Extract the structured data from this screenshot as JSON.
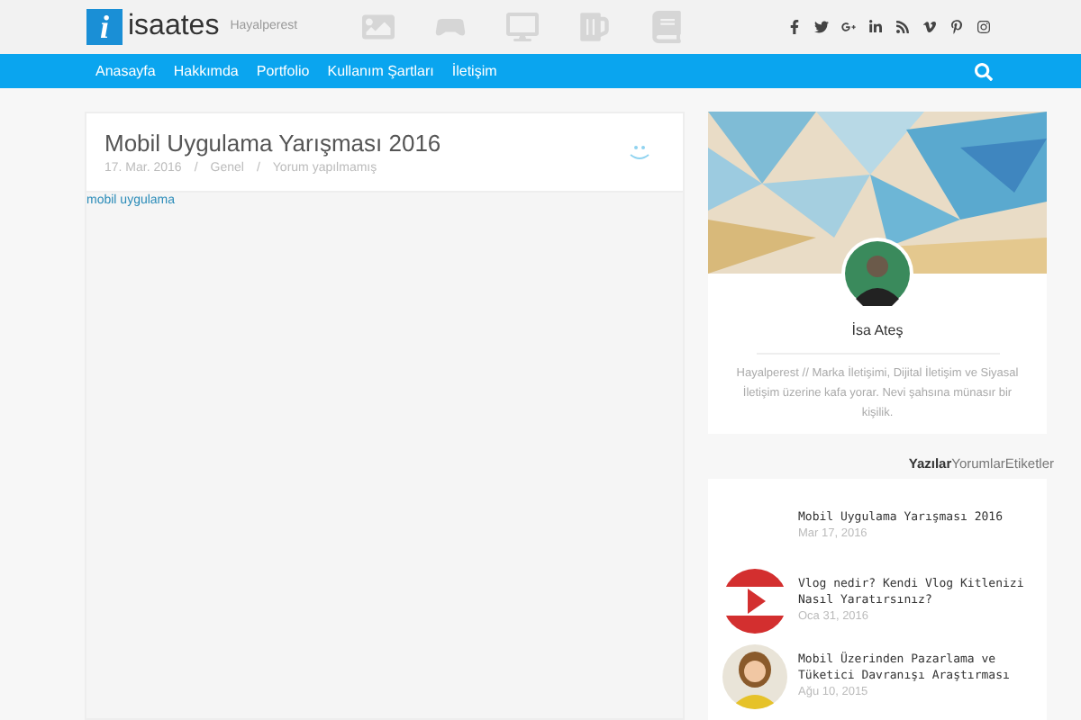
{
  "header": {
    "logo_letter": "i",
    "site_name": "isaates",
    "tagline": "Hayalperest"
  },
  "nav": {
    "items": [
      "Anasayfa",
      "Hakkımda",
      "Portfolio",
      "Kullanım Şartları",
      "İletişim"
    ]
  },
  "post": {
    "title": "Mobil Uygulama Yarışması 2016",
    "date": "17. Mar. 2016",
    "category": "Genel",
    "comments": "Yorum yapılmamış",
    "separator": "/",
    "image_alt": "mobil uygulama"
  },
  "profile": {
    "name": "İsa Ateş",
    "bio": "Hayalperest // Marka İletişimi, Dijital İletişim ve Siyasal İletişim üzerine kafa yorar. Nevi şahsına münasır bir kişilik."
  },
  "tabs": [
    {
      "label": "Yazılar",
      "selected": true
    },
    {
      "label": "Yorumlar",
      "selected": false
    },
    {
      "label": "Etiketler",
      "selected": false
    }
  ],
  "recent_posts": [
    {
      "kind": "blank",
      "title": "Mobil Uygulama Yarışması 2016",
      "date": "Mar 17, 2016"
    },
    {
      "kind": "video",
      "title": "Vlog nedir? Kendi Vlog Kitlenizi Nasıl Yaratırsınız?",
      "date": "Oca 31, 2016"
    },
    {
      "title": "Mobil Üzerinden Pazarlama ve Tüketici Davranışı Araştırması",
      "date": "Ağu 10, 2015"
    }
  ]
}
